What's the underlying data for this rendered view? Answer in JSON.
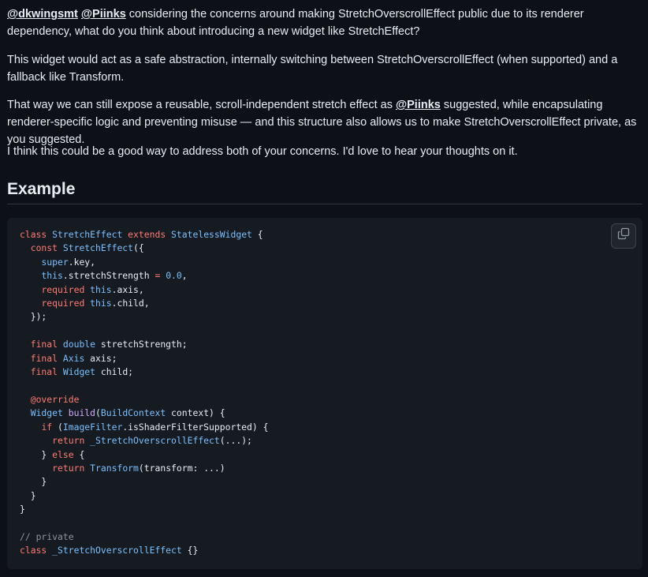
{
  "comment": {
    "para1": {
      "mention1": "@dkwingsmt",
      "mention2": "@Piinks",
      "text": " considering the concerns around making StretchOverscrollEffect public due to its renderer dependency, what do you think about introducing a new widget like StretchEffect?"
    },
    "para2": "This widget would act as a safe abstraction, internally switching between StretchOverscrollEffect (when supported) and a fallback like Transform.",
    "para3": {
      "before": "That way we can still expose a reusable, scroll-independent stretch effect as ",
      "mention": "@Piinks",
      "after": " suggested, while encapsulating renderer-specific logic and preventing misuse — and this structure also allows us to make StretchOverscrollEffect private, as you suggested."
    },
    "para4": "I think this could be a good way to address both of your concerns. I'd love to hear your thoughts on it.",
    "heading": "Example"
  },
  "code": {
    "language": "dart",
    "lines": [
      "class StretchEffect extends StatelessWidget {",
      "  const StretchEffect({",
      "    super.key,",
      "    this.stretchStrength = 0.0,",
      "    required this.axis,",
      "    required this.child,",
      "  });",
      "",
      "  final double stretchStrength;",
      "  final Axis axis;",
      "  final Widget child;",
      "",
      "  @override",
      "  Widget build(BuildContext context) {",
      "    if (ImageFilter.isShaderFilterSupported) {",
      "      return _StretchOverscrollEffect(...);",
      "    } else {",
      "      return Transform(transform: ...)",
      "    }",
      "  }",
      "}",
      "",
      "// private",
      "class _StretchOverscrollEffect {}"
    ],
    "copy_icon": "copy-icon"
  }
}
